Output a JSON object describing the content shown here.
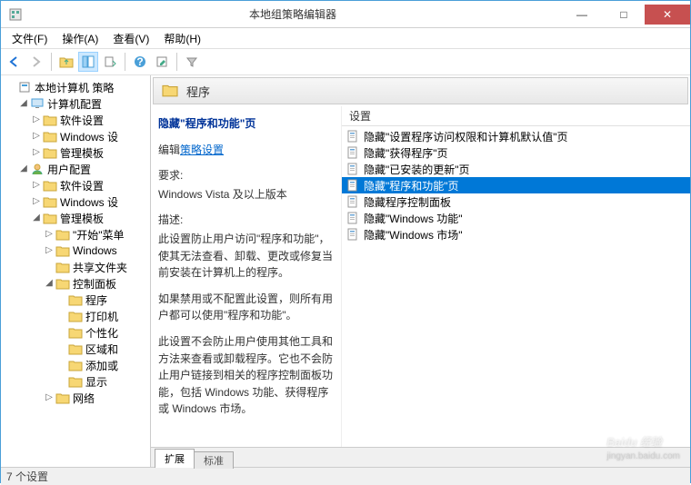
{
  "window": {
    "title": "本地组策略编辑器",
    "buttons": {
      "min": "—",
      "max": "□",
      "close": "✕"
    }
  },
  "menu": [
    "文件(F)",
    "操作(A)",
    "查看(V)",
    "帮助(H)"
  ],
  "tree": {
    "root": "本地计算机 策略",
    "computer": "计算机配置",
    "c_soft": "软件设置",
    "c_win": "Windows 设",
    "c_tmpl": "管理模板",
    "user": "用户配置",
    "u_soft": "软件设置",
    "u_win": "Windows 设",
    "u_tmpl": "管理模板",
    "start": "\"开始\"菜单",
    "wincomp": "Windows",
    "share": "共享文件夹",
    "ctrlpanel": "控制面板",
    "programs": "程序",
    "printer": "打印机",
    "personal": "个性化",
    "region": "区域和",
    "add": "添加或",
    "display": "显示",
    "network": "网络"
  },
  "header": {
    "title": "程序"
  },
  "desc": {
    "title": "隐藏\"程序和功能\"页",
    "edit_label": "编辑",
    "edit_link": "策略设置",
    "req_label": "要求:",
    "req_text": "Windows Vista 及以上版本",
    "desc_label": "描述:",
    "p1": "此设置防止用户访问\"程序和功能\"，使其无法查看、卸载、更改或修复当前安装在计算机上的程序。",
    "p2": "如果禁用或不配置此设置，则所有用户都可以使用\"程序和功能\"。",
    "p3": "此设置不会防止用户使用其他工具和方法来查看或卸载程序。它也不会防止用户链接到相关的程序控制面板功能，包括 Windows 功能、获得程序 或 Windows 市场。"
  },
  "list": {
    "col": "设置",
    "items": [
      "隐藏\"设置程序访问权限和计算机默认值\"页",
      "隐藏\"获得程序\"页",
      "隐藏\"已安装的更新\"页",
      "隐藏\"程序和功能\"页",
      "隐藏程序控制面板",
      "隐藏\"Windows 功能\"",
      "隐藏\"Windows 市场\""
    ],
    "selected_index": 3
  },
  "tabs": {
    "ext": "扩展",
    "std": "标准"
  },
  "status": "7 个设置",
  "watermark": {
    "main": "Baidu 经验",
    "sub": "jingyan.baidu.com"
  }
}
